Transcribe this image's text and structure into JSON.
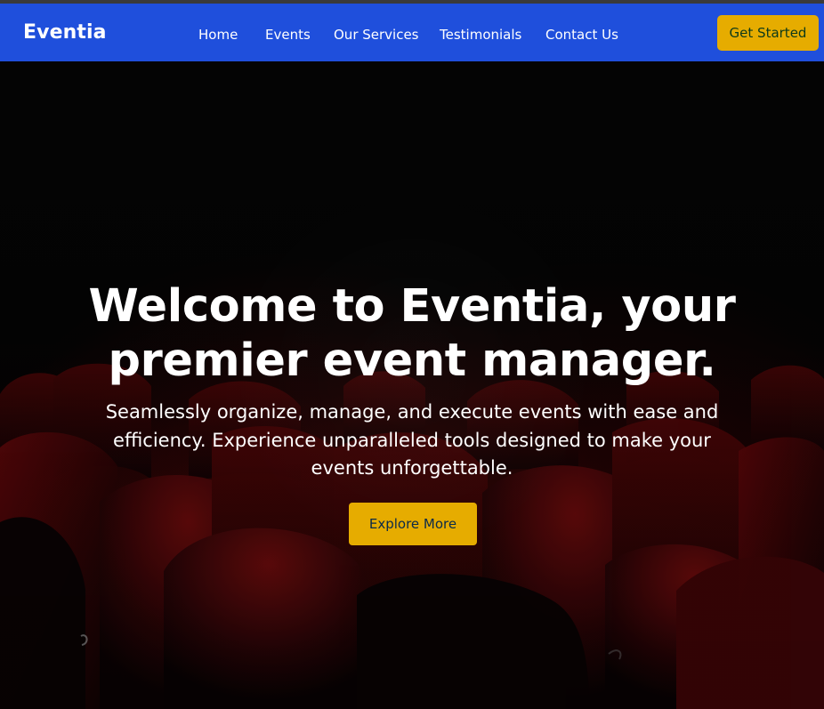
{
  "navbar": {
    "brand": "Eventia",
    "links": [
      "Home",
      "Events",
      "Our Services",
      "Testimonials",
      "Contact Us"
    ],
    "cta_label": "Get Started"
  },
  "hero": {
    "title_line_1": "Welcome to Eventia, your",
    "title_line_2": "premier event manager.",
    "subtitle": "Seamlessly organize, manage, and execute events with ease and efficiency. Experience unparalleled tools designed to make your events unforgettable.",
    "button_label": "Explore More",
    "background_icon": "theater-seats"
  },
  "colors": {
    "navbar_background": "#1f4fdc",
    "accent": "#e6ac00",
    "hero_background": "#040404",
    "seat_red": "#5a0606"
  }
}
